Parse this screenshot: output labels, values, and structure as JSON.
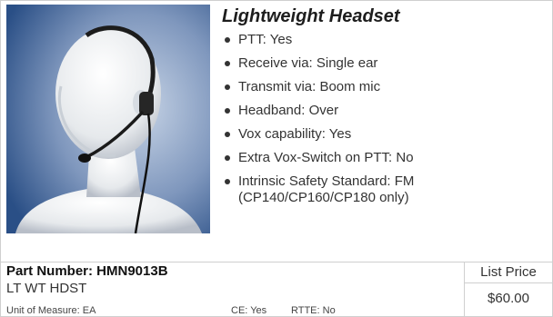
{
  "product": {
    "title": "Lightweight Headset",
    "image_icon": "headset-on-mannequin",
    "specs": [
      "PTT: Yes",
      "Receive via: Single ear",
      "Transmit via: Boom mic",
      "Headband: Over",
      "Vox capability: Yes",
      "Extra Vox-Switch on PTT: No",
      "Intrinsic Safety Standard: FM (CP140/CP160/CP180 only)"
    ]
  },
  "footer": {
    "part_number": "Part Number: HMN9013B",
    "short_description": "LT WT HDST",
    "unit_of_measure": "Unit of Measure: EA",
    "ce": "CE: Yes",
    "rtte": "RTTE: No",
    "list_price_label": "List Price",
    "list_price_value": "$60.00"
  },
  "colors": {
    "border": "#cfcfcf",
    "mannequin": "#e9ecef",
    "background_blue": "#2a4f86"
  }
}
